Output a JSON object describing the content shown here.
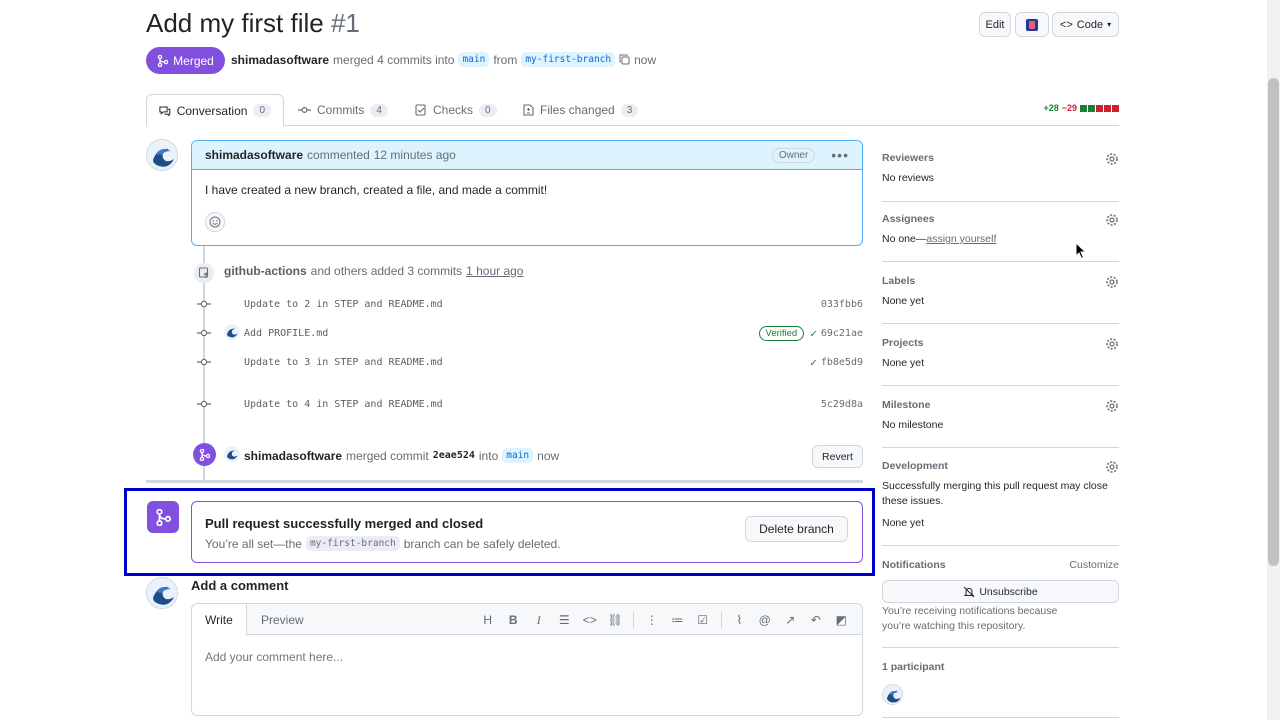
{
  "header": {
    "title": "Add my first file",
    "number": "#1",
    "edit_label": "Edit",
    "code_label": "Code",
    "state": "Merged",
    "author": "shimadasoftware",
    "merged_text": "merged 4 commits into",
    "base_branch": "main",
    "from_text": "from",
    "head_branch": "my-first-branch",
    "time": "now"
  },
  "tabs": [
    {
      "label": "Conversation",
      "count": "0"
    },
    {
      "label": "Commits",
      "count": "4"
    },
    {
      "label": "Checks",
      "count": "0"
    },
    {
      "label": "Files changed",
      "count": "3"
    }
  ],
  "diffstat": {
    "added": "+28",
    "removed": "−29",
    "colors": [
      "#1a7f37",
      "#1a7f37",
      "#cf222e",
      "#cf222e",
      "#cf222e"
    ]
  },
  "comment": {
    "author": "shimadasoftware",
    "action": "commented",
    "time": "12 minutes ago",
    "role": "Owner",
    "body": "I have created a new branch, created a file, and made a commit!"
  },
  "commits_event": {
    "actor": "github-actions",
    "text": "and others added 3 commits",
    "time": "1 hour ago",
    "commits": [
      {
        "message": "Update to 2 in STEP and README.md",
        "sha": "033fbb6",
        "verified": "",
        "check": false,
        "avatar": false
      },
      {
        "message": "Add PROFILE.md",
        "sha": "69c21ae",
        "verified": "Verified",
        "check": true,
        "avatar": true
      },
      {
        "message": "Update to 3 in STEP and README.md",
        "sha": "fb8e5d9",
        "verified": "",
        "check": true,
        "avatar": false
      },
      {
        "message": "Update to 4 in STEP and README.md",
        "sha": "5c29d8a",
        "verified": "",
        "check": false,
        "avatar": false
      }
    ]
  },
  "merge_event": {
    "author": "shimadasoftware",
    "text": "merged commit",
    "sha": "2eae524",
    "into": "into",
    "branch": "main",
    "time": "now",
    "revert_label": "Revert"
  },
  "merge_box": {
    "title": "Pull request successfully merged and closed",
    "sub_prefix": "You’re all set—the",
    "branch": "my-first-branch",
    "sub_suffix": "branch can be safely deleted.",
    "delete_label": "Delete branch"
  },
  "new_comment": {
    "title": "Add a comment",
    "write_tab": "Write",
    "preview_tab": "Preview",
    "placeholder": "Add your comment here..."
  },
  "sidebar": {
    "reviewers": {
      "label": "Reviewers",
      "value": "No reviews"
    },
    "assignees": {
      "label": "Assignees",
      "value": "No one—",
      "link": "assign yourself"
    },
    "labels": {
      "label": "Labels",
      "value": "None yet"
    },
    "projects": {
      "label": "Projects",
      "value": "None yet"
    },
    "milestone": {
      "label": "Milestone",
      "value": "No milestone"
    },
    "development": {
      "label": "Development",
      "text": "Successfully merging this pull request may close these issues.",
      "value": "None yet"
    },
    "notifications": {
      "label": "Notifications",
      "customize": "Customize",
      "button": "Unsubscribe",
      "text": "You’re receiving notifications because you’re watching this repository."
    },
    "participants": {
      "label": "1 participant"
    }
  }
}
